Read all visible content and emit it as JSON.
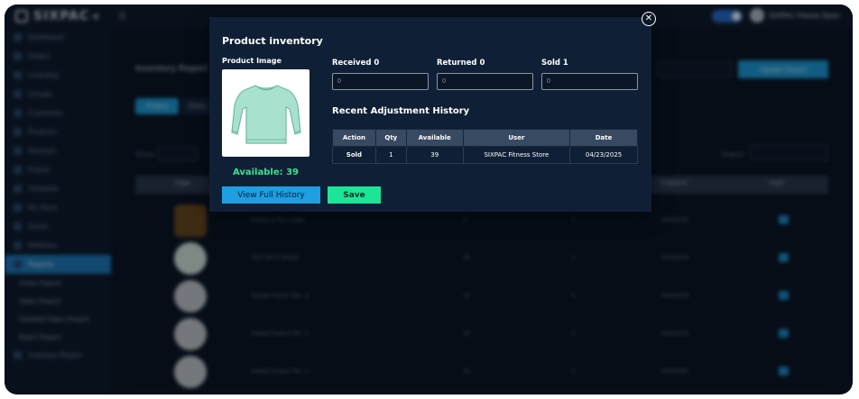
{
  "app": {
    "brand": "SIXPAC",
    "store_name": "SIXPAC Fitness Store"
  },
  "background": {
    "page_title": "Inventory Report",
    "tabs": [
      "Product",
      "Event"
    ],
    "show_label": "Show",
    "show_value": "10",
    "update_button": "Update Report",
    "search_label": "Search:",
    "sidebar": [
      {
        "label": "Dashboard",
        "active": false,
        "sub": false
      },
      {
        "label": "Orders",
        "active": false,
        "sub": false
      },
      {
        "label": "Licensing",
        "active": false,
        "sub": false
      },
      {
        "label": "Groups",
        "active": false,
        "sub": false
      },
      {
        "label": "Customers",
        "active": false,
        "sub": false
      },
      {
        "label": "Products",
        "active": false,
        "sub": false
      },
      {
        "label": "Services",
        "active": false,
        "sub": false
      },
      {
        "label": "Events",
        "active": false,
        "sub": false
      },
      {
        "label": "Schedule",
        "active": false,
        "sub": false
      },
      {
        "label": "My Store",
        "active": false,
        "sub": false
      },
      {
        "label": "Social",
        "active": false,
        "sub": false
      },
      {
        "label": "Wellness",
        "active": false,
        "sub": false
      },
      {
        "label": "Reports",
        "active": true,
        "sub": false
      },
      {
        "label": "Order Report",
        "active": false,
        "sub": true
      },
      {
        "label": "Sales Report",
        "active": false,
        "sub": true
      },
      {
        "label": "Detailed Sales Report",
        "active": false,
        "sub": true
      },
      {
        "label": "Batch Report",
        "active": false,
        "sub": true
      },
      {
        "label": "Inventory Report",
        "active": false,
        "sub": false
      }
    ],
    "table_headers": [
      "Image",
      "Created At",
      "Action"
    ],
    "rows": [
      {
        "thumb": "brown",
        "title": "Product w/ Test Image",
        "c1": "0",
        "c2": "0",
        "c3": "04/30/2025"
      },
      {
        "thumb": "mint",
        "title": "TEST WITH IMAGE",
        "c1": "39",
        "c2": "1",
        "c3": "04/15/2025"
      },
      {
        "thumb": "grey",
        "title": "Sample Product Title - 8",
        "c1": "40",
        "c2": "0",
        "c3": "04/15/2025"
      },
      {
        "thumb": "grey",
        "title": "Sample Product Title - 6",
        "c1": "40",
        "c2": "0",
        "c3": "04/15/2025"
      },
      {
        "thumb": "grey",
        "title": "Sample Product Title - 5",
        "c1": "40",
        "c2": "0",
        "c3": "04/15/2025"
      }
    ]
  },
  "modal": {
    "title": "Product inventory",
    "image_label": "Product Image",
    "available_text": "Available: 39",
    "fields": [
      {
        "label": "Received 0",
        "placeholder": "0"
      },
      {
        "label": "Returned 0",
        "placeholder": "0"
      },
      {
        "label": "Sold 1",
        "placeholder": "0"
      }
    ],
    "history_title": "Recent Adjustment History",
    "history_headers": [
      "Action",
      "Qty",
      "Available",
      "User",
      "Date"
    ],
    "history_rows": [
      [
        "Sold",
        "1",
        "39",
        "SIXPAC Fitness Store",
        "04/23/2025"
      ]
    ],
    "view_history_button": "View Full History",
    "save_button": "Save",
    "close_icon": "close-circle-icon",
    "colors": {
      "available": "#3ee08f",
      "primary_button": "#1f9ee2",
      "save_button": "#1de597"
    }
  }
}
